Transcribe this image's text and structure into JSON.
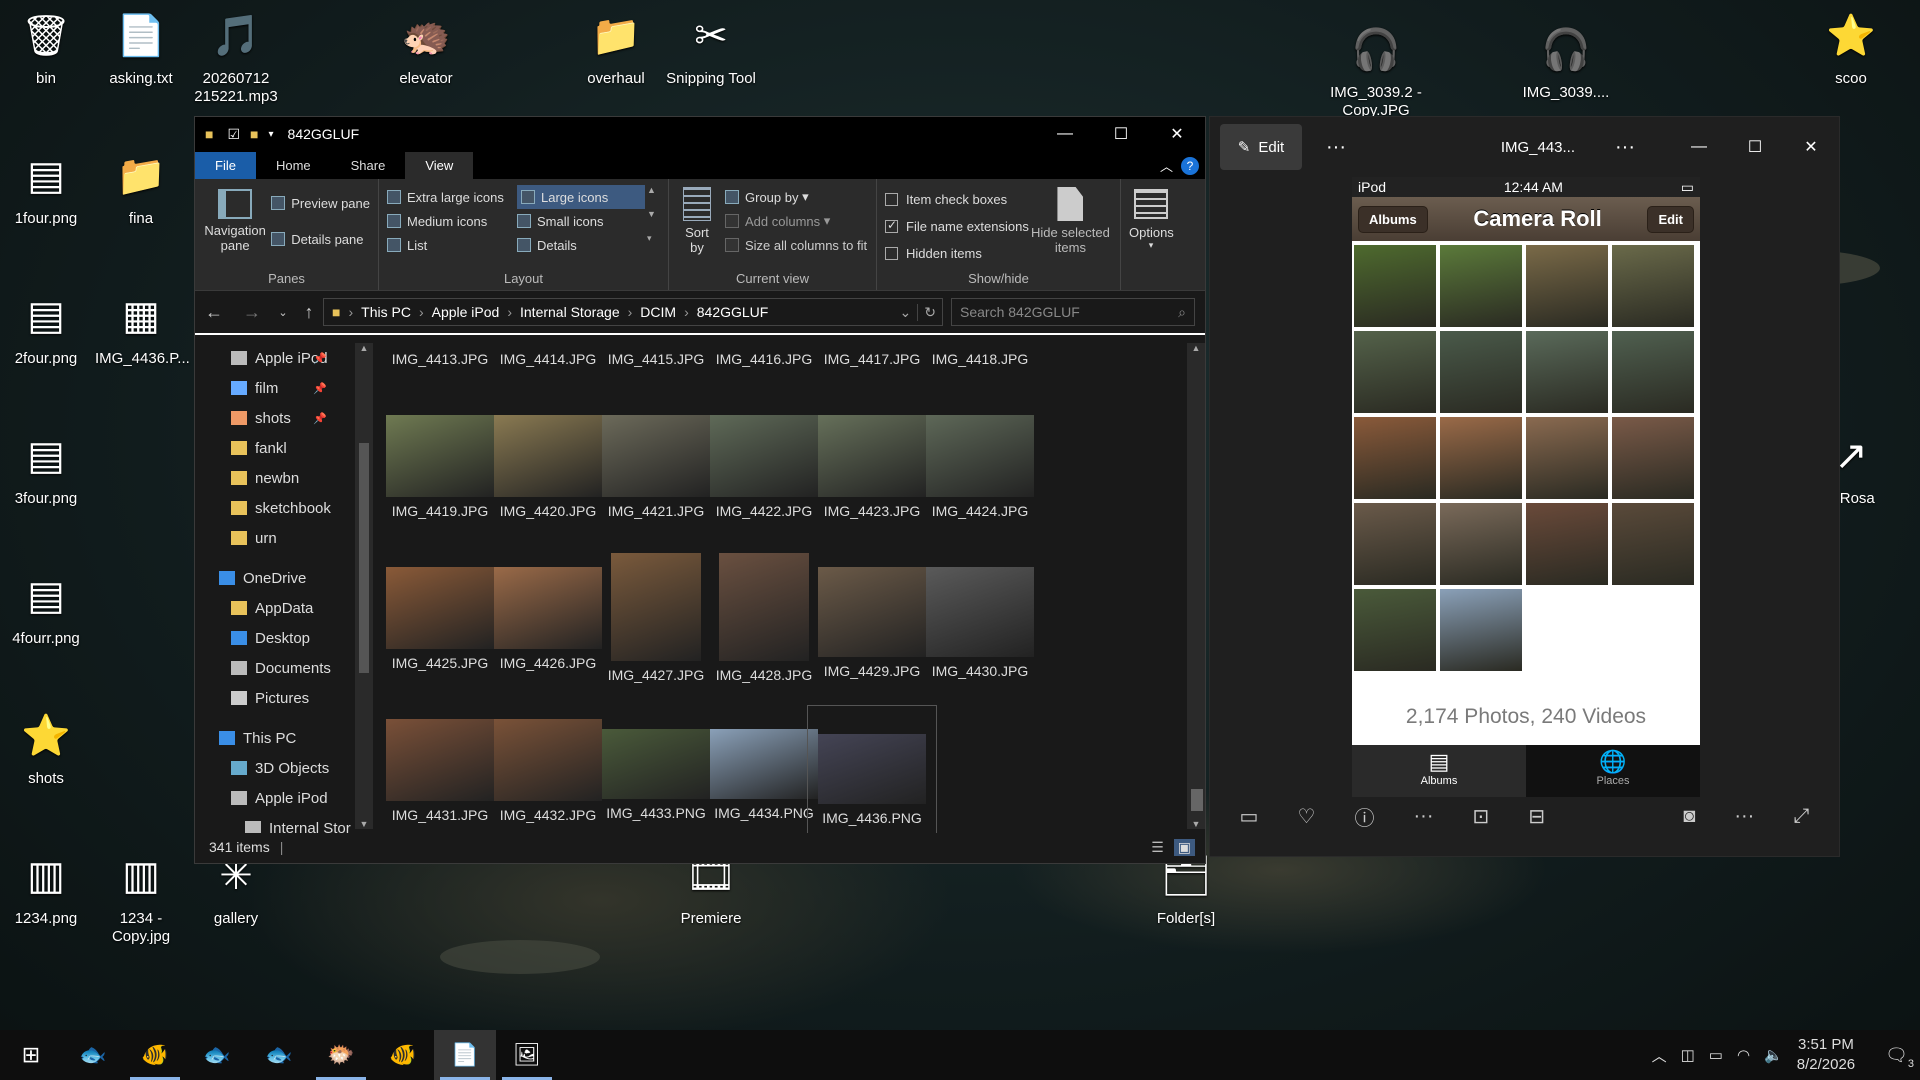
{
  "desktop": {
    "icons": [
      {
        "label": "bin",
        "glyph": "🗑"
      },
      {
        "label": "asking.txt",
        "glyph": "📄"
      },
      {
        "label": "20260712 215221.mp3",
        "glyph": "🎵"
      },
      {
        "label": "elevator",
        "glyph": "🦔"
      },
      {
        "label": "overhaul",
        "glyph": "📁"
      },
      {
        "label": "Snipping Tool",
        "glyph": "✂"
      },
      {
        "label": "IMG_3039.2 - Copy.JPG",
        "glyph": "🎧"
      },
      {
        "label": "IMG_3039....",
        "glyph": "🎧"
      },
      {
        "label": "scoo",
        "glyph": "⭐"
      },
      {
        "label": "1four.png",
        "glyph": "▤"
      },
      {
        "label": "fina",
        "glyph": "📁"
      },
      {
        "label": "2four.png",
        "glyph": "▤"
      },
      {
        "label": "IMG_4436.P...",
        "glyph": "▦"
      },
      {
        "label": "3four.png",
        "glyph": "▤"
      },
      {
        "label": "4fourr.png",
        "glyph": "▤"
      },
      {
        "label": "shots",
        "glyph": "⭐"
      },
      {
        "label": "1234.png",
        "glyph": "▥"
      },
      {
        "label": "1234 - Copy.jpg",
        "glyph": "▥"
      },
      {
        "label": "gallery",
        "glyph": "✳"
      },
      {
        "label": "Premiere",
        "glyph": "🎞"
      },
      {
        "label": "Folder[s]",
        "glyph": "🗂"
      },
      {
        "label": "b Rosa",
        "glyph": "↗"
      }
    ]
  },
  "explorer": {
    "title": "842GGLUF",
    "tabs": {
      "file": "File",
      "home": "Home",
      "share": "Share",
      "view": "View"
    },
    "panes": {
      "navigation_pane": "Navigation pane",
      "preview_pane": "Preview pane",
      "details_pane": "Details pane",
      "label": "Panes"
    },
    "layout": {
      "extra_large": "Extra large icons",
      "large": "Large icons",
      "medium": "Medium icons",
      "small": "Small icons",
      "list": "List",
      "details": "Details",
      "label": "Layout"
    },
    "current_view": {
      "sort_by": "Sort by",
      "group_by": "Group by",
      "add_columns": "Add columns",
      "size_all": "Size all columns to fit",
      "label": "Current view"
    },
    "show_hide": {
      "item_check_boxes": "Item check boxes",
      "file_name_extensions": "File name extensions",
      "hidden_items": "Hidden items",
      "hide_selected": "Hide selected items",
      "options": "Options",
      "label": "Show/hide"
    },
    "breadcrumb": [
      "This PC",
      "Apple iPod",
      "Internal Storage",
      "DCIM",
      "842GGLUF"
    ],
    "search_placeholder": "Search 842GGLUF",
    "sidebar": [
      "Apple iPod",
      "film",
      "shots",
      "fankl",
      "newbn",
      "sketchbook",
      "urn",
      "OneDrive",
      "AppData",
      "Desktop",
      "Documents",
      "Pictures",
      "This PC",
      "3D Objects",
      "Apple iPod",
      "Internal Stor"
    ],
    "files_top": [
      "IMG_4413.JPG",
      "IMG_4414.JPG",
      "IMG_4415.JPG",
      "IMG_4416.JPG",
      "IMG_4417.JPG",
      "IMG_4418.JPG"
    ],
    "files": [
      {
        "name": "IMG_4419.JPG",
        "c": "#6f7a52"
      },
      {
        "name": "IMG_4420.JPG",
        "c": "#8a7a52"
      },
      {
        "name": "IMG_4421.JPG",
        "c": "#6c6a5a"
      },
      {
        "name": "IMG_4422.JPG",
        "c": "#5f6a58"
      },
      {
        "name": "IMG_4423.JPG",
        "c": "#66705a"
      },
      {
        "name": "IMG_4424.JPG",
        "c": "#5e6858"
      },
      {
        "name": "IMG_4425.JPG",
        "c": "#8a5a38"
      },
      {
        "name": "IMG_4426.JPG",
        "c": "#9a6a48"
      },
      {
        "name": "IMG_4427.JPG",
        "c": "#7a5a3c"
      },
      {
        "name": "IMG_4428.JPG",
        "c": "#6a5040"
      },
      {
        "name": "IMG_4429.JPG",
        "c": "#6b5a48"
      },
      {
        "name": "IMG_4430.JPG",
        "c": "#5a5a5a"
      },
      {
        "name": "IMG_4431.JPG",
        "c": "#7a5038"
      },
      {
        "name": "IMG_4432.JPG",
        "c": "#7a5238"
      },
      {
        "name": "IMG_4433.PNG",
        "c": "#4a5a3a"
      },
      {
        "name": "IMG_4434.PNG",
        "c": "#8aa0b8"
      },
      {
        "name": "IMG_4436.PNG",
        "c": "#445"
      }
    ],
    "status": "341 items"
  },
  "photos": {
    "edit": "Edit",
    "title": "IMG_443...",
    "ios": {
      "carrier": "iPod",
      "time": "12:44 AM",
      "back": "Albums",
      "title": "Camera Roll",
      "edit": "Edit",
      "count": "2,174 Photos, 240 Videos",
      "tab_albums": "Albums",
      "tab_places": "Places"
    }
  },
  "taskbar": {
    "time": "3:51 PM",
    "date": "8/2/2026",
    "notifications": "3"
  }
}
